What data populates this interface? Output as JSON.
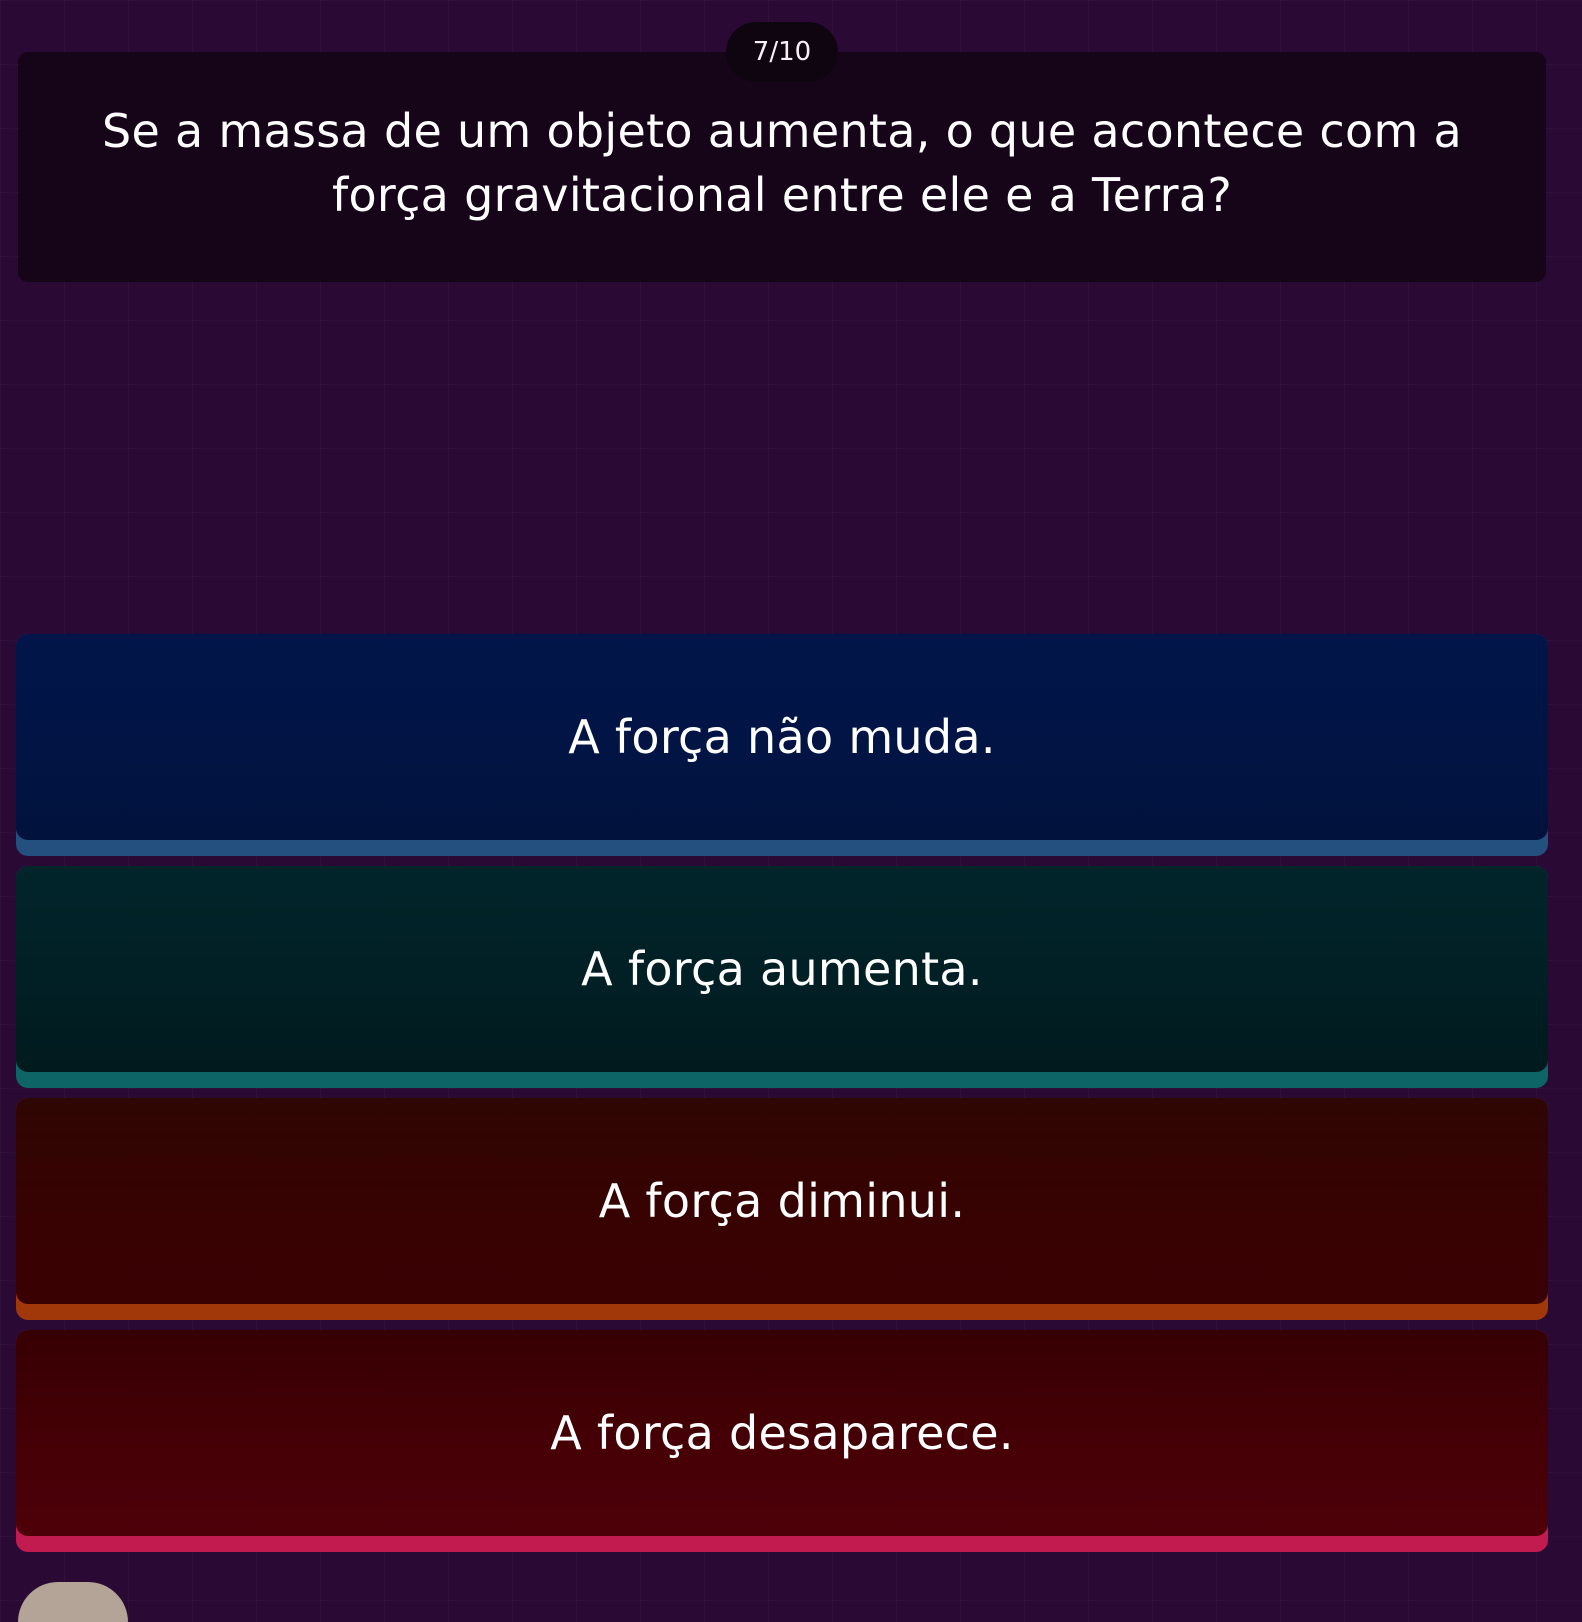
{
  "quiz": {
    "progress": "7/10",
    "question": "Se a massa de um objeto aumenta, o que acontece com a força gravitacional entre ele e a Terra?",
    "options": [
      {
        "label": "A força não muda.",
        "color": "#24507f"
      },
      {
        "label": "A força aumenta.",
        "color": "#0e6566"
      },
      {
        "label": "A força diminui.",
        "color": "#a0380a"
      },
      {
        "label": "A força desaparece.",
        "color": "#c11b50"
      }
    ]
  },
  "colors": {
    "background": "#2a0a35",
    "question_card": "#120414",
    "counter_pill": "#0f0510"
  }
}
